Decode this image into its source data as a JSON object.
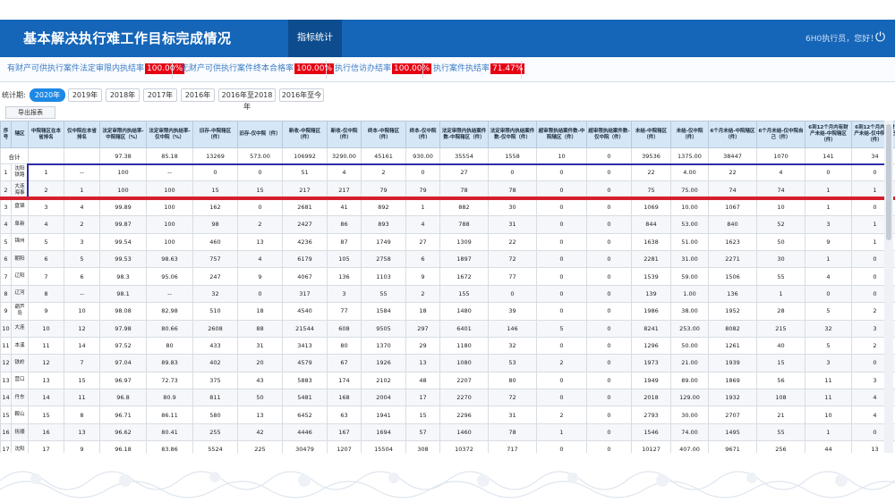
{
  "header": {
    "title": "基本解决执行难工作目标完成情况",
    "active_tab": "指标统计",
    "user_greeting": "6H0执行员，您好！",
    "power_icon": "power-icon"
  },
  "stats": [
    {
      "label": "有财产可供执行案件法定审限内执结率",
      "value": "100.00%"
    },
    {
      "label": "无财产可供执行案件终本合格率",
      "value": "100.00%"
    },
    {
      "label": "执行信访办结率",
      "value": "100.00%"
    },
    {
      "label": "执行案件执结率",
      "value": "71.47%"
    }
  ],
  "filter": {
    "label": "统计期:",
    "years": [
      "2020年",
      "2019年",
      "2018年",
      "2017年",
      "2016年",
      "2016年至2018年",
      "2016年至今"
    ],
    "active": "2020年"
  },
  "export_label": "导出报表",
  "table": {
    "headers": [
      "序号",
      "辖区",
      "中院辖区在本省排名",
      "仅中院在本省排名",
      "法定审限内执结率-中院辖区（%）",
      "法定审限内执结率-仅中院（%）",
      "旧存-中院辖区（件）",
      "旧存-仅中院（件）",
      "新收-中院辖区（件）",
      "新收-仅中院（件）",
      "终本-中院辖区（件）",
      "终本-仅中院（件）",
      "法定审限内执结案件数-中院辖区（件）",
      "法定审限内执结案件数-仅中院（件）",
      "超审限执结案件数-中院辖区（件）",
      "超审限执结案件数-仅中院（件）",
      "未结-中院辖区（件）",
      "未结-仅中院（件）",
      "6个月未结-中院辖区（件）",
      "6个月未结-仅中院自己（件）",
      "6到12个月内有财产未结-中院辖区（件）",
      "6到12个月内有财产未结-仅中院自己（件）"
    ],
    "total": [
      "合计",
      "",
      "",
      "97.38",
      "85.18",
      "13269",
      "573.00",
      "106992",
      "3290.00",
      "45161",
      "930.00",
      "35554",
      "1558",
      "10",
      "0",
      "39536",
      "1375.00",
      "38447",
      "1070",
      "141",
      "34"
    ],
    "rows": [
      [
        "1",
        "沈阳铁路",
        "1",
        "--",
        "100",
        "--",
        "0",
        "0",
        "51",
        "4",
        "2",
        "0",
        "27",
        "0",
        "0",
        "0",
        "22",
        "4.00",
        "22",
        "4",
        "0",
        "0"
      ],
      [
        "2",
        "大连海事",
        "2",
        "1",
        "100",
        "100",
        "15",
        "15",
        "217",
        "217",
        "79",
        "79",
        "78",
        "78",
        "0",
        "0",
        "75",
        "75.00",
        "74",
        "74",
        "1",
        "1"
      ],
      [
        "3",
        "盘锦",
        "3",
        "4",
        "99.89",
        "100",
        "162",
        "0",
        "2681",
        "41",
        "892",
        "1",
        "882",
        "30",
        "0",
        "0",
        "1069",
        "10.00",
        "1067",
        "10",
        "1",
        "0"
      ],
      [
        "4",
        "阜新",
        "4",
        "2",
        "99.87",
        "100",
        "98",
        "2",
        "2427",
        "86",
        "893",
        "4",
        "788",
        "31",
        "0",
        "0",
        "844",
        "53.00",
        "840",
        "52",
        "3",
        "1"
      ],
      [
        "5",
        "锦州",
        "5",
        "3",
        "99.54",
        "100",
        "460",
        "13",
        "4236",
        "87",
        "1749",
        "27",
        "1309",
        "22",
        "0",
        "0",
        "1638",
        "51.00",
        "1623",
        "50",
        "9",
        "1"
      ],
      [
        "6",
        "朝阳",
        "6",
        "5",
        "99.53",
        "98.63",
        "757",
        "4",
        "6179",
        "105",
        "2758",
        "6",
        "1897",
        "72",
        "0",
        "0",
        "2281",
        "31.00",
        "2271",
        "30",
        "1",
        "0"
      ],
      [
        "7",
        "辽阳",
        "7",
        "6",
        "98.3",
        "95.06",
        "247",
        "9",
        "4067",
        "136",
        "1103",
        "9",
        "1672",
        "77",
        "0",
        "0",
        "1539",
        "59.00",
        "1506",
        "55",
        "4",
        "0"
      ],
      [
        "8",
        "辽河",
        "8",
        "--",
        "98.1",
        "--",
        "32",
        "0",
        "317",
        "3",
        "55",
        "2",
        "155",
        "0",
        "0",
        "0",
        "139",
        "1.00",
        "136",
        "1",
        "0",
        "0"
      ],
      [
        "9",
        "葫芦岛",
        "9",
        "10",
        "98.08",
        "82.98",
        "510",
        "18",
        "4540",
        "77",
        "1584",
        "18",
        "1480",
        "39",
        "0",
        "0",
        "1986",
        "38.00",
        "1952",
        "28",
        "5",
        "2"
      ],
      [
        "10",
        "大连",
        "10",
        "12",
        "97.98",
        "80.66",
        "2608",
        "88",
        "21544",
        "608",
        "9505",
        "297",
        "6401",
        "146",
        "5",
        "0",
        "8241",
        "253.00",
        "8082",
        "215",
        "32",
        "3"
      ],
      [
        "11",
        "本溪",
        "11",
        "14",
        "97.52",
        "80",
        "433",
        "31",
        "3413",
        "80",
        "1370",
        "29",
        "1180",
        "32",
        "0",
        "0",
        "1296",
        "50.00",
        "1261",
        "40",
        "5",
        "2"
      ],
      [
        "12",
        "铁岭",
        "12",
        "7",
        "97.04",
        "89.83",
        "402",
        "20",
        "4579",
        "67",
        "1926",
        "13",
        "1080",
        "53",
        "2",
        "0",
        "1973",
        "21.00",
        "1939",
        "15",
        "3",
        "0"
      ],
      [
        "13",
        "营口",
        "13",
        "15",
        "96.97",
        "72.73",
        "375",
        "43",
        "5883",
        "174",
        "2102",
        "48",
        "2207",
        "80",
        "0",
        "0",
        "1949",
        "89.00",
        "1869",
        "56",
        "11",
        "3"
      ],
      [
        "14",
        "丹东",
        "14",
        "11",
        "96.8",
        "80.9",
        "811",
        "50",
        "5481",
        "168",
        "2004",
        "17",
        "2270",
        "72",
        "0",
        "0",
        "2018",
        "129.00",
        "1932",
        "108",
        "11",
        "4"
      ],
      [
        "15",
        "鞍山",
        "15",
        "8",
        "96.71",
        "86.11",
        "580",
        "13",
        "6452",
        "63",
        "1941",
        "15",
        "2296",
        "31",
        "2",
        "0",
        "2793",
        "30.00",
        "2707",
        "21",
        "10",
        "4"
      ],
      [
        "16",
        "抚顺",
        "16",
        "13",
        "96.62",
        "80.41",
        "255",
        "42",
        "4446",
        "167",
        "1694",
        "57",
        "1460",
        "78",
        "1",
        "0",
        "1546",
        "74.00",
        "1495",
        "55",
        "1",
        "0"
      ],
      [
        "17",
        "沈阳",
        "17",
        "9",
        "96.18",
        "83.86",
        "5524",
        "225",
        "30479",
        "1207",
        "15504",
        "308",
        "10372",
        "717",
        "0",
        "0",
        "10127",
        "407.00",
        "9671",
        "256",
        "44",
        "13"
      ]
    ]
  }
}
